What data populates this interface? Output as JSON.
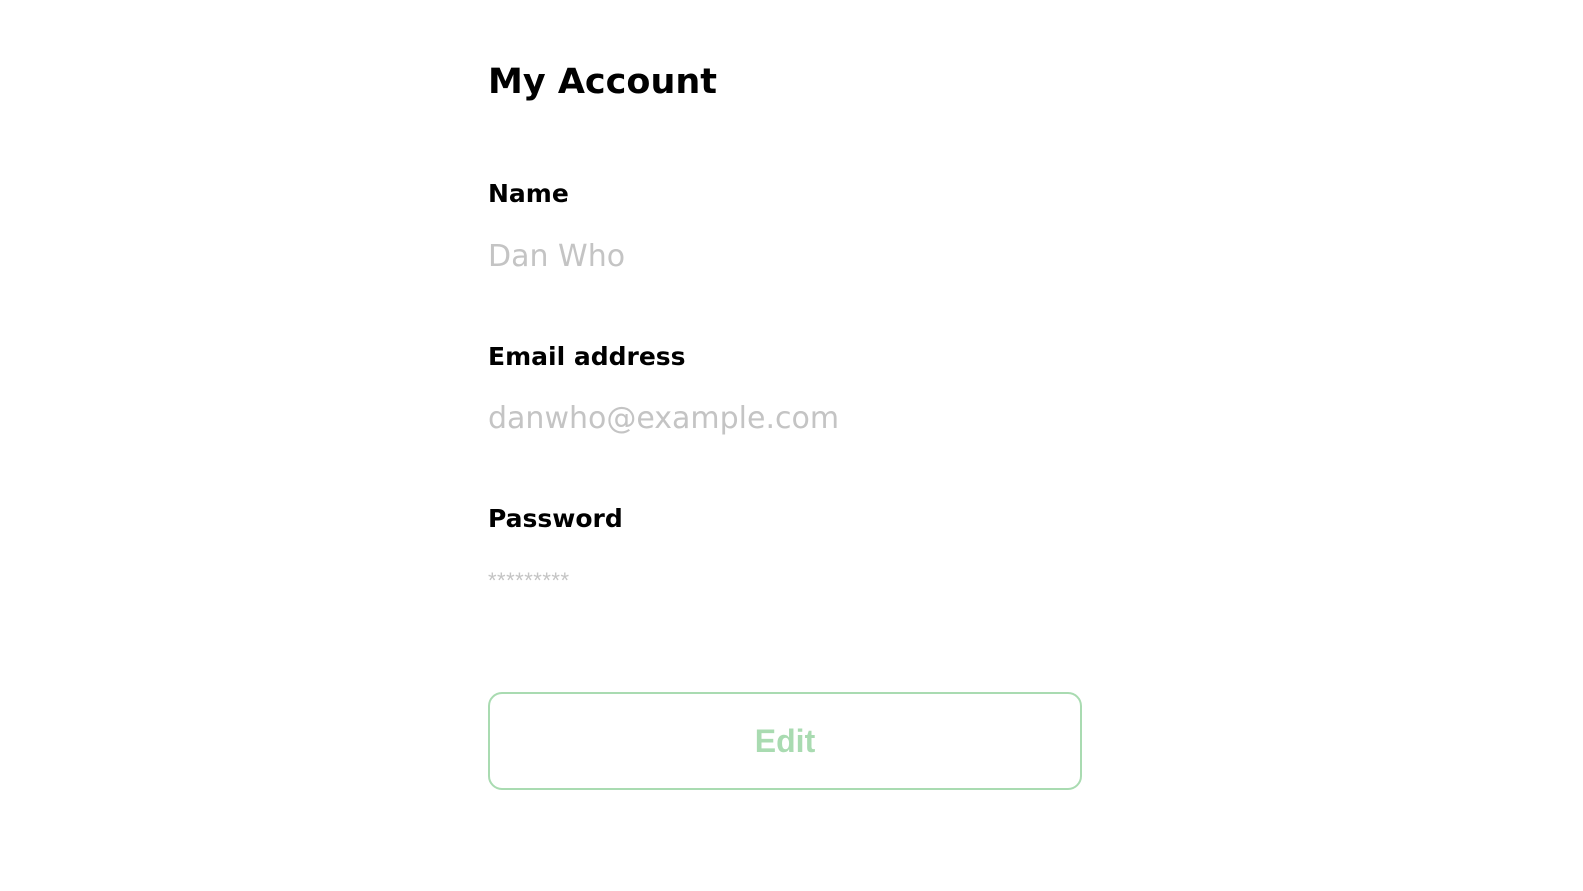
{
  "page": {
    "title": "My Account"
  },
  "fields": {
    "name": {
      "label": "Name",
      "value": "Dan Who"
    },
    "email": {
      "label": "Email address",
      "value": "danwho@example.com"
    },
    "password": {
      "label": "Password",
      "value": "*********"
    }
  },
  "actions": {
    "edit_label": "Edit"
  },
  "colors": {
    "accent": "#a9dbb1",
    "value_text": "#c4c4c4",
    "label_text": "#000000",
    "background": "#ffffff"
  }
}
